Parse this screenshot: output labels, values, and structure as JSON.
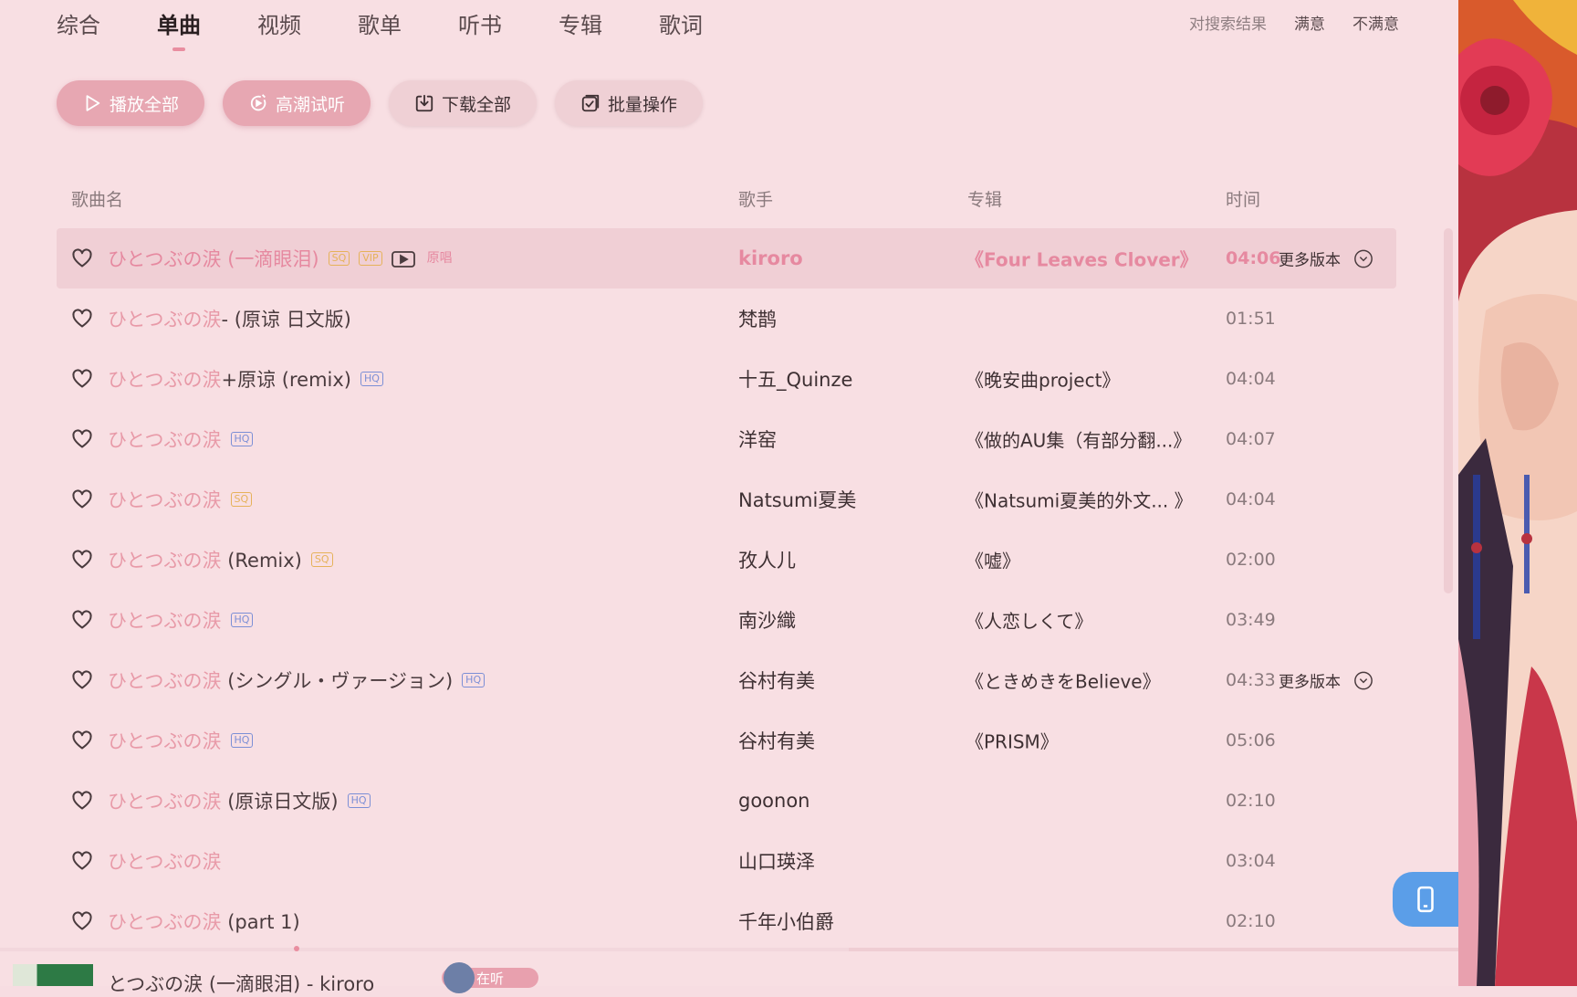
{
  "tabs": [
    "综合",
    "单曲",
    "视频",
    "歌单",
    "听书",
    "专辑",
    "歌词"
  ],
  "active_tab_index": 1,
  "feedback": {
    "label": "对搜索结果",
    "satisfied": "满意",
    "unsatisfied": "不满意"
  },
  "toolbar": {
    "play_all": "播放全部",
    "highlight": "高潮试听",
    "download_all": "下载全部",
    "batch": "批量操作"
  },
  "columns": {
    "title": "歌曲名",
    "artist": "歌手",
    "album": "专辑",
    "time": "时间"
  },
  "more_versions": "更多版本",
  "songs": [
    {
      "jp": "ひとつぶの涙",
      "suffix": " (一滴眼泪)",
      "badges": [
        "SQ",
        "VIP"
      ],
      "mv": true,
      "hot": "原唱",
      "artist": "kiroro",
      "album": "《Four Leaves Clover》",
      "time": "04:06",
      "more": true,
      "selected": true
    },
    {
      "jp": "ひとつぶの涙",
      "suffix": "- (原谅 日文版)",
      "badges": [],
      "artist": "梵鹊",
      "album": "",
      "time": "01:51"
    },
    {
      "jp": "ひとつぶの涙",
      "suffix": "+原谅 (remix)",
      "badges": [
        "HQ"
      ],
      "artist": "十五_Quinze",
      "album": "《晚安曲project》",
      "time": "04:04"
    },
    {
      "jp": "ひとつぶの涙",
      "suffix": "",
      "badges": [
        "HQ"
      ],
      "artist": "洋窑",
      "album": "《做的AU集（有部分翻...》",
      "time": "04:07"
    },
    {
      "jp": "ひとつぶの涙",
      "suffix": "",
      "badges": [
        "SQ"
      ],
      "artist": "Natsumi夏美",
      "album": "《Natsumi夏美的外文... 》",
      "time": "04:04"
    },
    {
      "jp": "ひとつぶの涙",
      "suffix": " (Remix)",
      "badges": [
        "SQ"
      ],
      "artist": "孜人儿",
      "album": "《嘘》",
      "time": "02:00"
    },
    {
      "jp": "ひとつぶの涙",
      "suffix": "",
      "badges": [
        "HQ"
      ],
      "artist": "南沙織",
      "album": "《人恋しくて》",
      "time": "03:49"
    },
    {
      "jp": "ひとつぶの涙",
      "suffix": " (シングル・ヴァージョン)",
      "badges": [
        "HQ"
      ],
      "artist": "谷村有美",
      "album": "《ときめきをBelieve》",
      "time": "04:33",
      "more": true
    },
    {
      "jp": "ひとつぶの涙",
      "suffix": "",
      "badges": [
        "HQ"
      ],
      "artist": "谷村有美",
      "album": "《PRISM》",
      "time": "05:06"
    },
    {
      "jp": "ひとつぶの涙",
      "suffix": " (原谅日文版)",
      "badges": [
        "HQ"
      ],
      "artist": "goonon",
      "album": "",
      "time": "02:10"
    },
    {
      "jp": "ひとつぶの涙",
      "suffix": "",
      "badges": [],
      "artist": "山口瑛泽",
      "album": "",
      "time": "03:04"
    },
    {
      "jp": "ひとつぶの涙",
      "suffix": " (part 1)",
      "badges": [],
      "artist": "千年小伯爵",
      "album": "",
      "time": "02:10"
    }
  ],
  "player": {
    "now_playing": "とつぶの涙 (一滴眼泪) - kiroro",
    "status": "在听",
    "progress": 0.2
  },
  "icons": {
    "heart": "heart-outline-icon",
    "play": "play-icon",
    "highlight": "highlight-play-icon",
    "download": "download-icon",
    "batch": "batch-check-icon",
    "mv": "mv-icon",
    "chevron": "chevron-down-icon",
    "phone": "phone-icon"
  },
  "colors": {
    "background": "#f8dfe3",
    "accent": "#e98ea0",
    "primary_button": "#e7a7b2",
    "hq": "#7c8fd6",
    "sq": "#e6b25a",
    "phone_button": "#5b9ee8"
  }
}
